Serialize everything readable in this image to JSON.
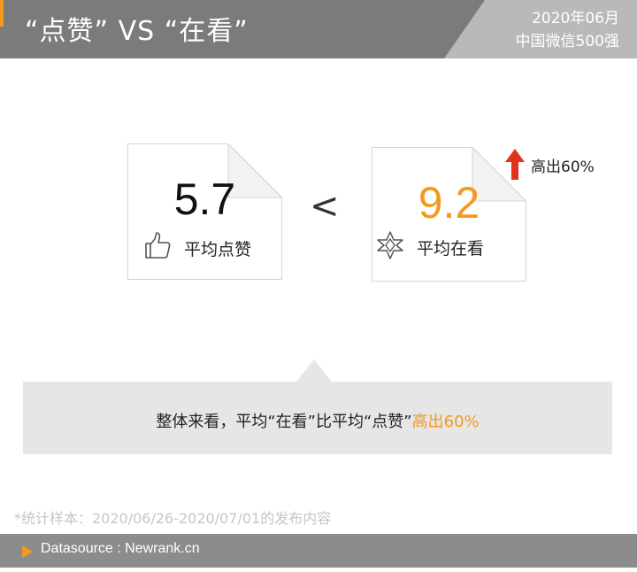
{
  "header": {
    "title": "“点赞” VS “在看”",
    "date_line1": "2020年06月",
    "date_line2": "中国微信500强"
  },
  "cards": {
    "like": {
      "value": "5.7",
      "label": "平均点赞",
      "icon": "thumbs-up-icon"
    },
    "watch": {
      "value": "9.2",
      "label": "平均在看",
      "icon": "star-icon"
    },
    "comparator": "<"
  },
  "badge": {
    "icon": "arrow-up-icon",
    "text": "高出60%"
  },
  "summary": {
    "prefix": "整体来看，平均“在看”比平均“点赞”",
    "highlight": "高出60%"
  },
  "footnote": "*统计样本：2020/06/26-2020/07/01的发布内容",
  "footer": {
    "icon": "play-triangle-icon",
    "text": "Datasource : Newrank.cn"
  },
  "colors": {
    "header_bg": "#7b7b7b",
    "header_corner": "#b9b9b9",
    "accent_orange": "#f39a1e",
    "arrow_red": "#e0321e",
    "summary_bg": "#e6e6e6",
    "footer_bg": "#8c8c8c"
  }
}
